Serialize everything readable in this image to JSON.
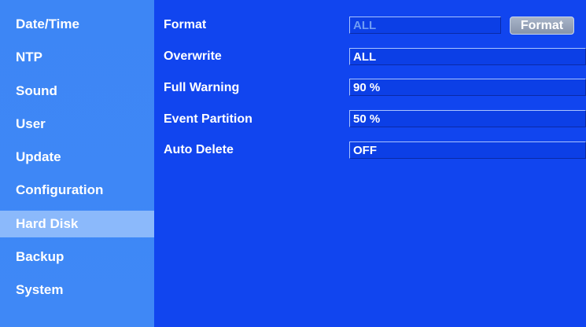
{
  "sidebar": {
    "items": [
      {
        "label": "Date/Time"
      },
      {
        "label": "NTP"
      },
      {
        "label": "Sound"
      },
      {
        "label": "User"
      },
      {
        "label": "Update"
      },
      {
        "label": "Configuration"
      },
      {
        "label": "Hard Disk",
        "selected": true
      },
      {
        "label": "Backup"
      },
      {
        "label": "System"
      }
    ]
  },
  "hdd": {
    "format": {
      "label": "Format",
      "value": "ALL",
      "button_label": "Format"
    },
    "overwrite": {
      "label": "Overwrite",
      "value": "ALL"
    },
    "full_warning": {
      "label": "Full Warning",
      "value": "90 %"
    },
    "event_partition": {
      "label": "Event Partition",
      "value": "50 %"
    },
    "auto_delete": {
      "label": "Auto Delete",
      "value": "OFF"
    }
  },
  "colors": {
    "background": "#1145ef",
    "sidebar": "#3f88f6",
    "sidebar_selected": "#8bb9fb"
  }
}
